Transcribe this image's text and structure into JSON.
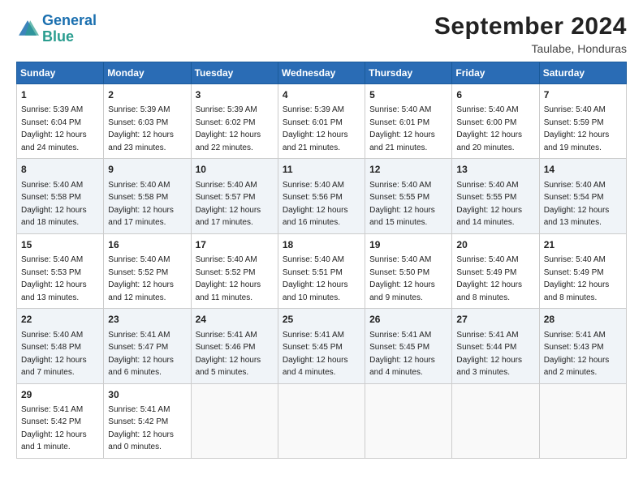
{
  "header": {
    "logo_line1": "General",
    "logo_line2": "Blue",
    "month": "September 2024",
    "location": "Taulabe, Honduras"
  },
  "weekdays": [
    "Sunday",
    "Monday",
    "Tuesday",
    "Wednesday",
    "Thursday",
    "Friday",
    "Saturday"
  ],
  "weeks": [
    [
      {
        "day": 1,
        "sunrise": "5:39 AM",
        "sunset": "6:04 PM",
        "daylight": "12 hours and 24 minutes."
      },
      {
        "day": 2,
        "sunrise": "5:39 AM",
        "sunset": "6:03 PM",
        "daylight": "12 hours and 23 minutes."
      },
      {
        "day": 3,
        "sunrise": "5:39 AM",
        "sunset": "6:02 PM",
        "daylight": "12 hours and 22 minutes."
      },
      {
        "day": 4,
        "sunrise": "5:39 AM",
        "sunset": "6:01 PM",
        "daylight": "12 hours and 21 minutes."
      },
      {
        "day": 5,
        "sunrise": "5:40 AM",
        "sunset": "6:01 PM",
        "daylight": "12 hours and 21 minutes."
      },
      {
        "day": 6,
        "sunrise": "5:40 AM",
        "sunset": "6:00 PM",
        "daylight": "12 hours and 20 minutes."
      },
      {
        "day": 7,
        "sunrise": "5:40 AM",
        "sunset": "5:59 PM",
        "daylight": "12 hours and 19 minutes."
      }
    ],
    [
      {
        "day": 8,
        "sunrise": "5:40 AM",
        "sunset": "5:58 PM",
        "daylight": "12 hours and 18 minutes."
      },
      {
        "day": 9,
        "sunrise": "5:40 AM",
        "sunset": "5:58 PM",
        "daylight": "12 hours and 17 minutes."
      },
      {
        "day": 10,
        "sunrise": "5:40 AM",
        "sunset": "5:57 PM",
        "daylight": "12 hours and 17 minutes."
      },
      {
        "day": 11,
        "sunrise": "5:40 AM",
        "sunset": "5:56 PM",
        "daylight": "12 hours and 16 minutes."
      },
      {
        "day": 12,
        "sunrise": "5:40 AM",
        "sunset": "5:55 PM",
        "daylight": "12 hours and 15 minutes."
      },
      {
        "day": 13,
        "sunrise": "5:40 AM",
        "sunset": "5:55 PM",
        "daylight": "12 hours and 14 minutes."
      },
      {
        "day": 14,
        "sunrise": "5:40 AM",
        "sunset": "5:54 PM",
        "daylight": "12 hours and 13 minutes."
      }
    ],
    [
      {
        "day": 15,
        "sunrise": "5:40 AM",
        "sunset": "5:53 PM",
        "daylight": "12 hours and 13 minutes."
      },
      {
        "day": 16,
        "sunrise": "5:40 AM",
        "sunset": "5:52 PM",
        "daylight": "12 hours and 12 minutes."
      },
      {
        "day": 17,
        "sunrise": "5:40 AM",
        "sunset": "5:52 PM",
        "daylight": "12 hours and 11 minutes."
      },
      {
        "day": 18,
        "sunrise": "5:40 AM",
        "sunset": "5:51 PM",
        "daylight": "12 hours and 10 minutes."
      },
      {
        "day": 19,
        "sunrise": "5:40 AM",
        "sunset": "5:50 PM",
        "daylight": "12 hours and 9 minutes."
      },
      {
        "day": 20,
        "sunrise": "5:40 AM",
        "sunset": "5:49 PM",
        "daylight": "12 hours and 8 minutes."
      },
      {
        "day": 21,
        "sunrise": "5:40 AM",
        "sunset": "5:49 PM",
        "daylight": "12 hours and 8 minutes."
      }
    ],
    [
      {
        "day": 22,
        "sunrise": "5:40 AM",
        "sunset": "5:48 PM",
        "daylight": "12 hours and 7 minutes."
      },
      {
        "day": 23,
        "sunrise": "5:41 AM",
        "sunset": "5:47 PM",
        "daylight": "12 hours and 6 minutes."
      },
      {
        "day": 24,
        "sunrise": "5:41 AM",
        "sunset": "5:46 PM",
        "daylight": "12 hours and 5 minutes."
      },
      {
        "day": 25,
        "sunrise": "5:41 AM",
        "sunset": "5:45 PM",
        "daylight": "12 hours and 4 minutes."
      },
      {
        "day": 26,
        "sunrise": "5:41 AM",
        "sunset": "5:45 PM",
        "daylight": "12 hours and 4 minutes."
      },
      {
        "day": 27,
        "sunrise": "5:41 AM",
        "sunset": "5:44 PM",
        "daylight": "12 hours and 3 minutes."
      },
      {
        "day": 28,
        "sunrise": "5:41 AM",
        "sunset": "5:43 PM",
        "daylight": "12 hours and 2 minutes."
      }
    ],
    [
      {
        "day": 29,
        "sunrise": "5:41 AM",
        "sunset": "5:42 PM",
        "daylight": "12 hours and 1 minute."
      },
      {
        "day": 30,
        "sunrise": "5:41 AM",
        "sunset": "5:42 PM",
        "daylight": "12 hours and 0 minutes."
      },
      null,
      null,
      null,
      null,
      null
    ]
  ]
}
